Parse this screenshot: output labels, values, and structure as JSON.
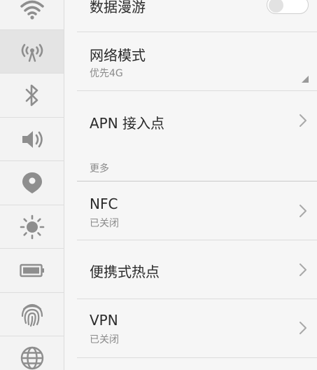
{
  "rail": {
    "items": [
      {
        "icon": "wifi-icon"
      },
      {
        "icon": "cellular-network-icon",
        "active": true
      },
      {
        "icon": "bluetooth-icon"
      },
      {
        "icon": "sound-icon"
      },
      {
        "icon": "location-icon"
      },
      {
        "icon": "brightness-icon"
      },
      {
        "icon": "battery-icon"
      },
      {
        "icon": "fingerprint-icon"
      },
      {
        "icon": "globe-icon"
      }
    ]
  },
  "settings": {
    "data_roaming": {
      "title": "数据漫游",
      "enabled": false
    },
    "network_mode": {
      "title": "网络模式",
      "value": "优先4G"
    },
    "apn": {
      "title": "APN 接入点"
    },
    "more_section": {
      "label": "更多"
    },
    "nfc": {
      "title": "NFC",
      "status": "已关闭"
    },
    "hotspot": {
      "title": "便携式热点"
    },
    "vpn": {
      "title": "VPN",
      "status": "已关闭"
    }
  },
  "colors": {
    "rail_bg": "#f3f3f3",
    "rail_active": "#e4e4e4",
    "icon_gray": "#8e8e8e",
    "text_primary": "#2b2b2b",
    "text_secondary": "#8a8a8a"
  }
}
